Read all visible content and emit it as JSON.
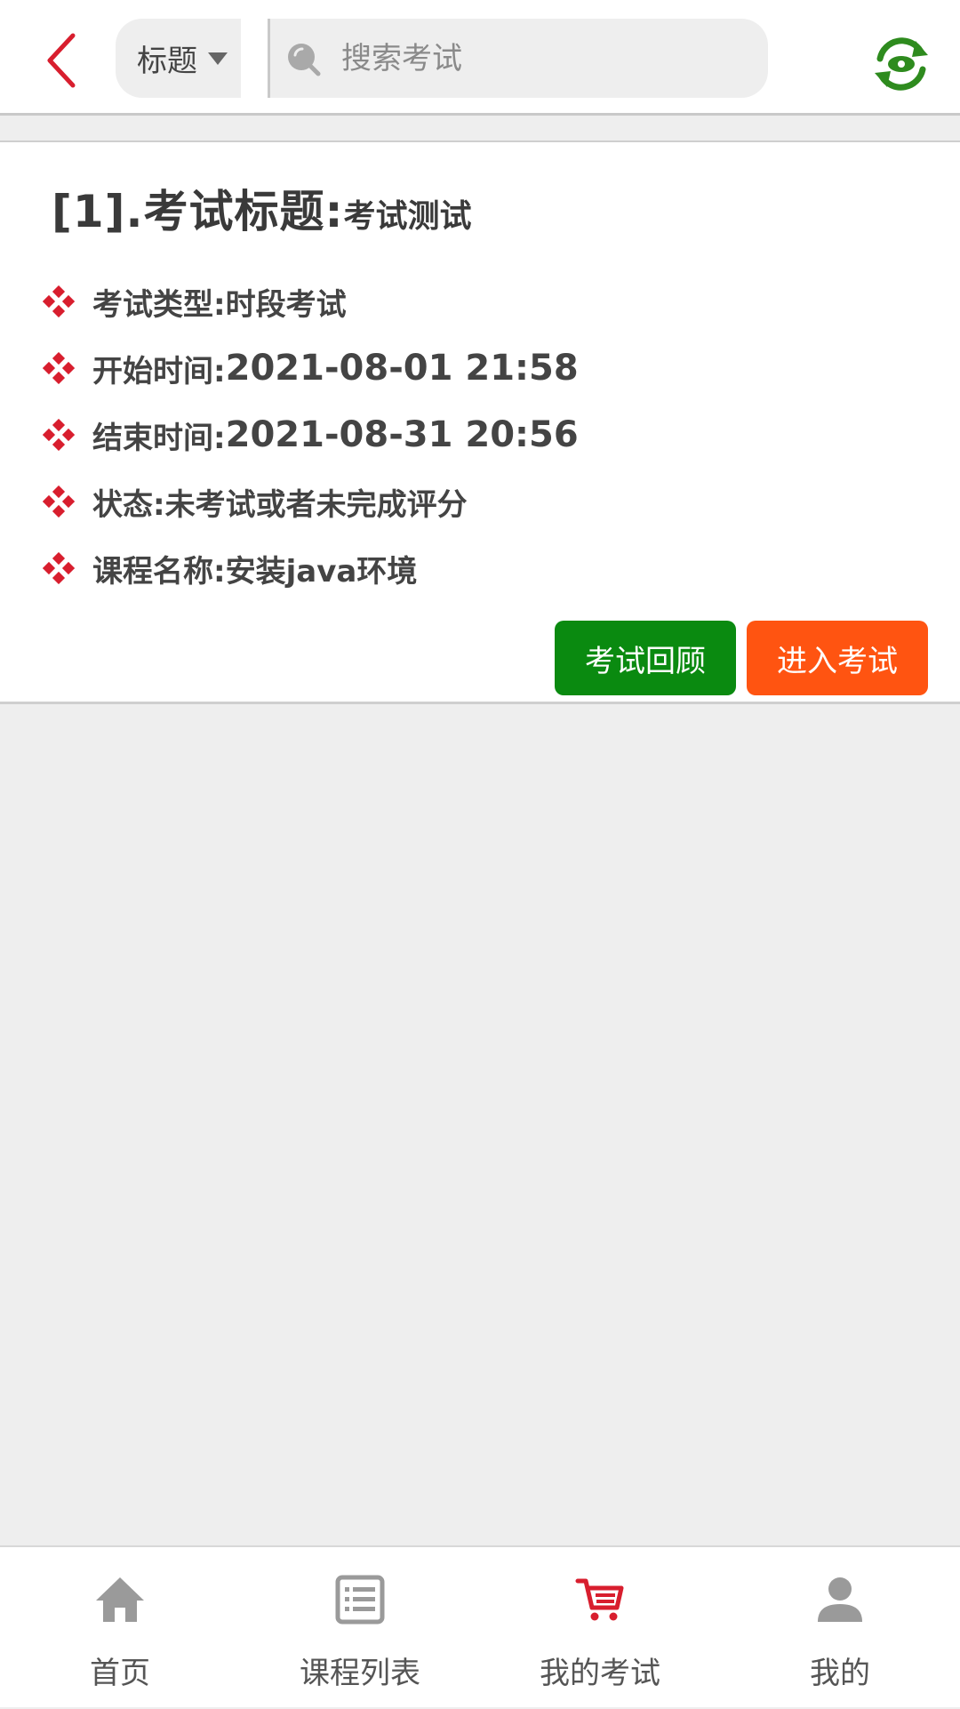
{
  "header": {
    "filter_label": "标题",
    "search_placeholder": "搜索考试"
  },
  "exam": {
    "title_prefix": "[1].考试标题:",
    "title_value": "考试测试",
    "fields": [
      {
        "label": "考试类型:",
        "value": "时段考试"
      },
      {
        "label": "开始时间:",
        "value": "2021-08-01  21:58"
      },
      {
        "label": "结束时间:",
        "value": "2021-08-31  20:56"
      },
      {
        "label": "状态:",
        "value": "未考试或者未完成评分"
      },
      {
        "label": "课程名称:",
        "value": "安装java环境"
      }
    ],
    "review_button": "考试回顾",
    "enter_button": "进入考试"
  },
  "nav": {
    "items": [
      {
        "label": "首页",
        "icon": "home-icon"
      },
      {
        "label": "课程列表",
        "icon": "list-icon"
      },
      {
        "label": "我的考试",
        "icon": "cart-icon",
        "active": true
      },
      {
        "label": "我的",
        "icon": "user-icon"
      }
    ]
  },
  "colors": {
    "accent_red": "#d81e2e",
    "review_green": "#0a8a10",
    "enter_orange": "#ff5411",
    "refresh_green": "#2e8b1e"
  }
}
